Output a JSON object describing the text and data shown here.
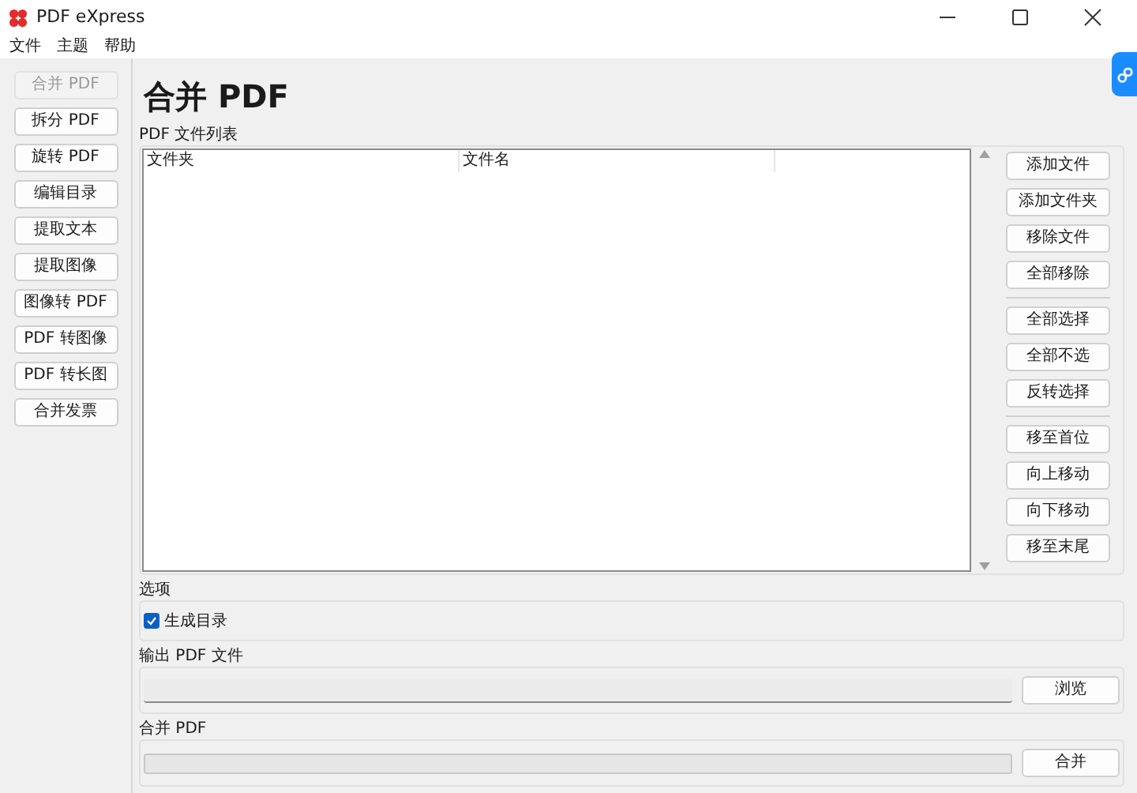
{
  "window": {
    "title": "PDF eXpress"
  },
  "menu": [
    "文件",
    "主题",
    "帮助"
  ],
  "sidebar": {
    "items": [
      {
        "label": "合并 PDF",
        "selected": true
      },
      {
        "label": "拆分 PDF",
        "selected": false
      },
      {
        "label": "旋转 PDF",
        "selected": false
      },
      {
        "label": "编辑目录",
        "selected": false
      },
      {
        "label": "提取文本",
        "selected": false
      },
      {
        "label": "提取图像",
        "selected": false
      },
      {
        "label": "图像转 PDF",
        "selected": false
      },
      {
        "label": "PDF 转图像",
        "selected": false
      },
      {
        "label": "PDF 转长图",
        "selected": false
      },
      {
        "label": "合并发票",
        "selected": false
      }
    ]
  },
  "page_title": "合并 PDF",
  "file_list": {
    "label": "PDF 文件列表",
    "columns": [
      "文件夹",
      "文件名"
    ]
  },
  "actions": [
    [
      "添加文件",
      "添加文件夹",
      "移除文件",
      "全部移除"
    ],
    [
      "全部选择",
      "全部不选",
      "反转选择"
    ],
    [
      "移至首位",
      "向上移动",
      "向下移动",
      "移至末尾"
    ]
  ],
  "options": {
    "label": "选项",
    "items": [
      {
        "label": "生成目录",
        "checked": true
      }
    ]
  },
  "output": {
    "label": "输出 PDF 文件",
    "button": "浏览"
  },
  "merge": {
    "label": "合并 PDF",
    "level": 0,
    "button": "合并"
  }
}
